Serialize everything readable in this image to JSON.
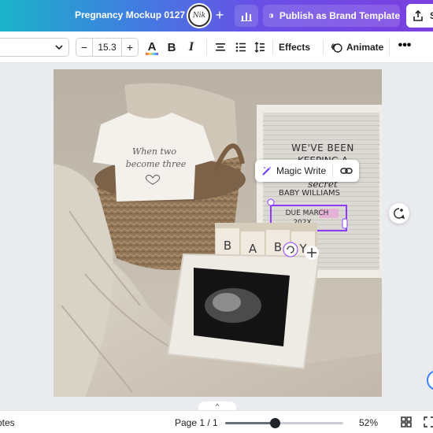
{
  "header": {
    "doc_title": "Pregnancy Mockup 0127",
    "avatar_initials": "Nik",
    "add_collaborator": "+",
    "publish_label": "Publish as Brand Template",
    "share_label": "S",
    "gradient_colors": [
      "#1bb3c9",
      "#3f7fe0",
      "#6a4fe6",
      "#7b3fe0"
    ]
  },
  "toolbar": {
    "font_name": "",
    "font_size": "15.3",
    "decrease_label": "−",
    "increase_label": "+",
    "color_label": "A",
    "bold_label": "B",
    "italic_label": "I",
    "effects_label": "Effects",
    "animate_label": "Animate",
    "more_label": "•••"
  },
  "canvas": {
    "onesie_text_line1": "When two",
    "onesie_text_line2": "become three",
    "letterboard": {
      "line1": "WE'VE BEEN",
      "line2": "KEEPING A",
      "line3": "secret",
      "line4": "BABY WILLIAMS",
      "line5": "DUE MARCH",
      "line6": "202X"
    },
    "blocks": [
      "B",
      "A",
      "B",
      "Y"
    ],
    "selection_color": "#8b3dff"
  },
  "magic_write": {
    "label": "Magic Write"
  },
  "bottom": {
    "notes_label": "otes",
    "page_label": "Page 1 / 1",
    "zoom_label": "52%",
    "zoom_fraction": 0.42,
    "collapse_label": "^"
  },
  "icons": [
    "analytics-icon",
    "publish-icon",
    "share-upload-icon",
    "chevron-down-icon",
    "text-color-icon",
    "align-center-icon",
    "bulleted-list-icon",
    "line-spacing-icon",
    "animate-icon",
    "magic-write-icon",
    "link-icon",
    "comment-add-icon",
    "rotate-icon",
    "move-icon",
    "grid-view-icon",
    "fullscreen-icon"
  ]
}
